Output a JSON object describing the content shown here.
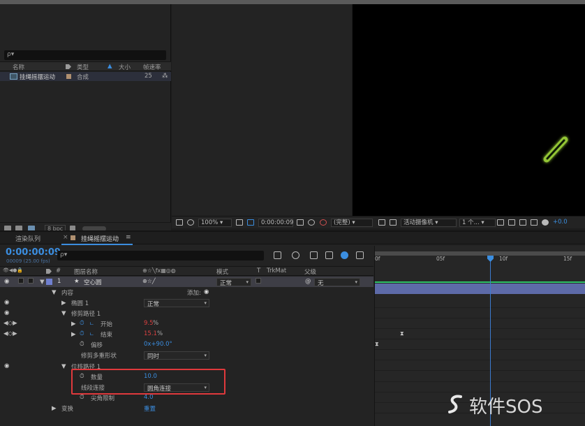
{
  "project": {
    "search_icon": "ρ▾",
    "columns": {
      "name": "名称",
      "type": "类型",
      "size": "大小",
      "fps": "帧速率"
    },
    "items": [
      {
        "name": "挂绳摇摆运动",
        "type": "合成",
        "fps": "25"
      }
    ],
    "bpc": "8 bpc"
  },
  "viewer": {
    "zoom": "100%",
    "timecode": "0:00:00:09",
    "quality": "(完整)",
    "camera": "活动摄像机",
    "views": "1 个...",
    "exposure": "+0.0"
  },
  "timeline": {
    "tabs": {
      "render_queue": "渲染队列",
      "comp": "挂绳摇摆运动"
    },
    "menu_icon": "≡",
    "close_icon": "×",
    "timecode": "0:00:00:09",
    "timecode_sub": "00009 (25.00 fps)",
    "search_icon": "ρ▾",
    "columns": {
      "num": "#",
      "layer_name": "图层名称",
      "mode": "模式",
      "t": "T",
      "trkmat": "TrkMat",
      "parent": "父级"
    },
    "ruler": {
      "t0": "0f",
      "t1": "05f",
      "t2": "10f",
      "t3": "15f"
    },
    "layer": {
      "num": "1",
      "star": "★",
      "name": "空心圆",
      "mode": "正常",
      "parent": "无",
      "parent_icon": "@"
    },
    "rows": {
      "contents": "内容",
      "add_label": "添加:",
      "ellipse": "椭圆 1",
      "ellipse_mode": "正常",
      "trim": "修剪路径 1",
      "start_label": "开始",
      "start_value": "9.5",
      "start_unit": "%",
      "end_label": "结束",
      "end_value": "15.1",
      "end_unit": "%",
      "offset_label": "偏移",
      "offset_value": "0x+90.0°",
      "trim_multi_label": "修剪多重形状",
      "trim_multi_value": "同时",
      "offset_path": "位移路径 1",
      "amount_label": "数量",
      "amount_value": "10.0",
      "line_join_label": "线段连接",
      "line_join_value": "圆角连接",
      "miter_label": "尖角限制",
      "miter_value": "4.0",
      "transform": "变换",
      "transform_value": "重置"
    }
  },
  "watermark": "软件SOS"
}
